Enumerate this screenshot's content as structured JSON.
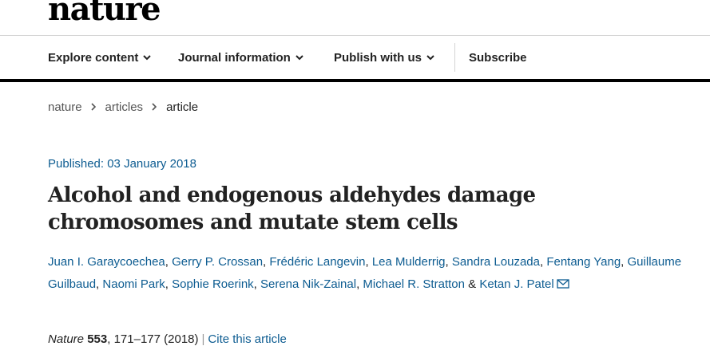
{
  "header": {
    "logo": "nature"
  },
  "nav": {
    "items": [
      {
        "label": "Explore content",
        "icon": "chevron-down-icon"
      },
      {
        "label": "Journal information",
        "icon": "chevron-down-icon"
      },
      {
        "label": "Publish with us",
        "icon": "chevron-down-icon"
      }
    ],
    "subscribe": "Subscribe"
  },
  "breadcrumb": {
    "items": [
      "nature",
      "articles"
    ],
    "current": "article",
    "separator_icon": "chevron-right-icon"
  },
  "article": {
    "published": "Published: 03 January 2018",
    "title": "Alcohol and endogenous aldehydes damage chromosomes and mutate stem cells",
    "authors": [
      "Juan I. Garaycoechea",
      "Gerry P. Crossan",
      "Frédéric Langevin",
      "Lea Mulderrig",
      "Sandra Louzada",
      "Fentang Yang",
      "Guillaume Guilbaud",
      "Naomi Park",
      "Sophie Roerink",
      "Serena Nik-Zainal",
      "Michael R. Stratton",
      "Ketan J. Patel"
    ],
    "author_sep": ",",
    "author_and": "&",
    "mail_icon": "envelope-icon",
    "citation": {
      "journal": "Nature",
      "volume": "553",
      "pages": "171–177",
      "year": "(2018)",
      "cite_link": "Cite this article"
    }
  },
  "colors": {
    "link": "#0d5c91",
    "text": "#222222",
    "rule": "#000000"
  }
}
